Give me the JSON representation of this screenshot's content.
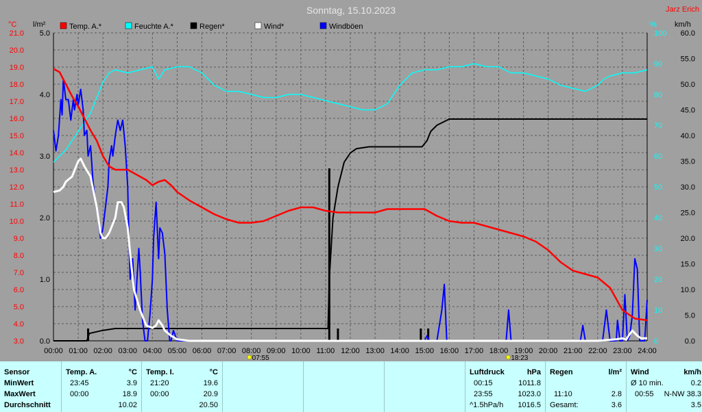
{
  "chart_data": {
    "type": "line",
    "title": "Sonntag, 15.10.2023",
    "station": "Jarz Erich",
    "legend": [
      {
        "name": "Temp. A.*",
        "color": "#ff0000"
      },
      {
        "name": "Feuchte A.*",
        "color": "#00ffff"
      },
      {
        "name": "Regen*",
        "color": "#000000"
      },
      {
        "name": "Wind*",
        "color": "#ffffff"
      },
      {
        "name": "Windböen",
        "color": "#0000ff"
      }
    ],
    "axes": {
      "temp": {
        "unit": "°C",
        "min": 3.0,
        "max": 21.0,
        "ticks": [
          "3.0",
          "4.0",
          "5.0",
          "6.0",
          "7.0",
          "8.0",
          "9.0",
          "10.0",
          "11.0",
          "12.0",
          "13.0",
          "14.0",
          "15.0",
          "16.0",
          "17.0",
          "18.0",
          "19.0",
          "20.0",
          "21.0"
        ]
      },
      "rain": {
        "unit": "l/m²",
        "min": 0.0,
        "max": 5.0,
        "ticks": [
          "0.0",
          "1.0",
          "2.0",
          "3.0",
          "4.0",
          "5.0"
        ]
      },
      "humidity": {
        "unit": "%",
        "min": 0,
        "max": 100,
        "ticks": [
          "0",
          "10",
          "20",
          "30",
          "40",
          "50",
          "60",
          "70",
          "80",
          "90",
          "100"
        ]
      },
      "wind": {
        "unit": "km/h",
        "min": 0.0,
        "max": 60.0,
        "ticks": [
          "0.0",
          "5.0",
          "10.0",
          "15.0",
          "20.0",
          "25.0",
          "30.0",
          "35.0",
          "40.0",
          "45.0",
          "50.0",
          "55.0",
          "60.0"
        ]
      },
      "x": {
        "min": 0,
        "max": 24,
        "ticks": [
          "00:00",
          "01:00",
          "02:00",
          "03:00",
          "04:00",
          "05:00",
          "06:00",
          "07:00",
          "08:00",
          "09:00",
          "10:00",
          "11:00",
          "12:00",
          "13:00",
          "14:00",
          "15:00",
          "16:00",
          "17:00",
          "18:00",
          "19:00",
          "20:00",
          "21:00",
          "22:00",
          "23:00",
          "24:00"
        ]
      }
    },
    "sunrise": {
      "label": "07:55",
      "hour": 7.917
    },
    "sunset": {
      "label": "18:23",
      "hour": 18.383
    },
    "series": {
      "temp": [
        [
          0,
          18.9
        ],
        [
          0.25,
          18.7
        ],
        [
          0.5,
          18.0
        ],
        [
          0.75,
          17.3
        ],
        [
          1.0,
          16.7
        ],
        [
          1.25,
          16.0
        ],
        [
          1.5,
          15.3
        ],
        [
          1.75,
          14.7
        ],
        [
          2.0,
          13.8
        ],
        [
          2.25,
          13.2
        ],
        [
          2.5,
          13.0
        ],
        [
          3.0,
          13.0
        ],
        [
          3.25,
          12.8
        ],
        [
          3.5,
          12.6
        ],
        [
          3.75,
          12.4
        ],
        [
          4.0,
          12.1
        ],
        [
          4.25,
          12.3
        ],
        [
          4.5,
          12.4
        ],
        [
          4.75,
          12.1
        ],
        [
          5.0,
          11.7
        ],
        [
          5.5,
          11.2
        ],
        [
          6.0,
          10.8
        ],
        [
          6.5,
          10.4
        ],
        [
          7.0,
          10.1
        ],
        [
          7.5,
          9.9
        ],
        [
          8.0,
          9.9
        ],
        [
          8.5,
          10.0
        ],
        [
          9.0,
          10.3
        ],
        [
          9.5,
          10.6
        ],
        [
          10.0,
          10.8
        ],
        [
          10.5,
          10.8
        ],
        [
          11.0,
          10.6
        ],
        [
          11.5,
          10.5
        ],
        [
          12.0,
          10.5
        ],
        [
          13.0,
          10.5
        ],
        [
          13.5,
          10.7
        ],
        [
          14.0,
          10.7
        ],
        [
          14.5,
          10.7
        ],
        [
          15.0,
          10.7
        ],
        [
          15.25,
          10.5
        ],
        [
          15.5,
          10.3
        ],
        [
          16.0,
          10.0
        ],
        [
          16.5,
          9.9
        ],
        [
          17.0,
          9.9
        ],
        [
          17.5,
          9.7
        ],
        [
          18.0,
          9.5
        ],
        [
          18.5,
          9.3
        ],
        [
          19.0,
          9.1
        ],
        [
          19.5,
          8.8
        ],
        [
          20.0,
          8.3
        ],
        [
          20.5,
          7.6
        ],
        [
          21.0,
          7.1
        ],
        [
          21.5,
          6.9
        ],
        [
          22.0,
          6.7
        ],
        [
          22.5,
          6.1
        ],
        [
          23.0,
          4.8
        ],
        [
          23.5,
          4.3
        ],
        [
          24.0,
          4.2
        ]
      ],
      "humidity": [
        [
          0,
          58
        ],
        [
          0.5,
          62
        ],
        [
          1.0,
          68
        ],
        [
          1.5,
          74
        ],
        [
          2.0,
          84
        ],
        [
          2.25,
          87
        ],
        [
          2.5,
          88
        ],
        [
          3.0,
          87
        ],
        [
          3.5,
          88
        ],
        [
          4.0,
          89
        ],
        [
          4.25,
          85
        ],
        [
          4.5,
          88
        ],
        [
          5.0,
          89
        ],
        [
          5.5,
          89
        ],
        [
          6.0,
          87
        ],
        [
          6.5,
          83
        ],
        [
          7.0,
          81
        ],
        [
          7.5,
          81
        ],
        [
          8.0,
          80
        ],
        [
          8.5,
          79
        ],
        [
          9.0,
          79
        ],
        [
          9.5,
          80
        ],
        [
          10.0,
          80
        ],
        [
          10.5,
          79
        ],
        [
          11.0,
          78
        ],
        [
          11.5,
          77
        ],
        [
          12.0,
          76
        ],
        [
          12.5,
          75
        ],
        [
          13.0,
          75
        ],
        [
          13.5,
          77
        ],
        [
          14.0,
          83
        ],
        [
          14.5,
          87
        ],
        [
          15.0,
          88
        ],
        [
          15.5,
          88
        ],
        [
          16.0,
          89
        ],
        [
          16.5,
          89
        ],
        [
          17.0,
          90
        ],
        [
          17.5,
          89
        ],
        [
          18.0,
          89
        ],
        [
          18.5,
          87
        ],
        [
          19.0,
          87
        ],
        [
          19.5,
          86
        ],
        [
          20.0,
          85
        ],
        [
          20.5,
          83
        ],
        [
          21.0,
          82
        ],
        [
          21.5,
          81
        ],
        [
          22.0,
          83
        ],
        [
          22.25,
          85
        ],
        [
          22.5,
          86
        ],
        [
          23.0,
          87
        ],
        [
          23.5,
          87
        ],
        [
          24.0,
          88
        ]
      ],
      "rain": [
        [
          0,
          0
        ],
        [
          1.35,
          0
        ],
        [
          1.45,
          0.12
        ],
        [
          2.0,
          0.17
        ],
        [
          2.5,
          0.2
        ],
        [
          3.0,
          0.2
        ],
        [
          4.0,
          0.2
        ],
        [
          5.0,
          0.2
        ],
        [
          6.0,
          0.2
        ],
        [
          7.0,
          0.2
        ],
        [
          8.0,
          0.2
        ],
        [
          9.0,
          0.2
        ],
        [
          10.0,
          0.2
        ],
        [
          11.0,
          0.2
        ],
        [
          11.1,
          0.2
        ],
        [
          11.15,
          1.0
        ],
        [
          11.3,
          2.0
        ],
        [
          11.5,
          2.5
        ],
        [
          11.75,
          2.9
        ],
        [
          12.0,
          3.05
        ],
        [
          12.25,
          3.12
        ],
        [
          12.75,
          3.15
        ],
        [
          13.0,
          3.15
        ],
        [
          14.0,
          3.15
        ],
        [
          14.9,
          3.15
        ],
        [
          15.1,
          3.25
        ],
        [
          15.25,
          3.4
        ],
        [
          15.5,
          3.5
        ],
        [
          15.75,
          3.55
        ],
        [
          16.0,
          3.6
        ],
        [
          17.0,
          3.6
        ],
        [
          18.0,
          3.6
        ],
        [
          19.0,
          3.6
        ],
        [
          20.0,
          3.6
        ],
        [
          21.0,
          3.6
        ],
        [
          22.0,
          3.6
        ],
        [
          23.0,
          3.6
        ],
        [
          24.0,
          3.6
        ]
      ],
      "rain_bars": [
        [
          1.4,
          0.2
        ],
        [
          11.15,
          2.8
        ],
        [
          11.5,
          0.2
        ],
        [
          14.85,
          0.2
        ],
        [
          15.15,
          0.2
        ]
      ],
      "wind": [
        [
          0,
          29
        ],
        [
          0.25,
          29.3
        ],
        [
          0.4,
          30
        ],
        [
          0.5,
          31
        ],
        [
          0.75,
          32
        ],
        [
          1.0,
          35
        ],
        [
          1.1,
          35.5
        ],
        [
          1.25,
          34
        ],
        [
          1.5,
          32
        ],
        [
          1.75,
          26
        ],
        [
          1.9,
          21
        ],
        [
          2.0,
          20
        ],
        [
          2.1,
          20
        ],
        [
          2.25,
          21
        ],
        [
          2.5,
          24
        ],
        [
          2.6,
          27
        ],
        [
          2.75,
          27
        ],
        [
          2.85,
          26
        ],
        [
          3.0,
          22
        ],
        [
          3.1,
          17
        ],
        [
          3.25,
          10
        ],
        [
          3.5,
          6
        ],
        [
          3.75,
          3
        ],
        [
          4.0,
          2.5
        ],
        [
          4.15,
          3
        ],
        [
          4.25,
          4
        ],
        [
          4.4,
          3
        ],
        [
          4.5,
          2
        ],
        [
          4.75,
          1
        ],
        [
          5.0,
          0.3
        ],
        [
          5.5,
          0
        ],
        [
          6,
          0
        ],
        [
          8,
          0
        ],
        [
          10,
          0
        ],
        [
          12,
          0
        ],
        [
          14,
          0
        ],
        [
          16,
          0
        ],
        [
          18,
          0
        ],
        [
          20,
          0
        ],
        [
          22,
          0
        ],
        [
          22.75,
          0.3
        ],
        [
          23.0,
          0.5
        ],
        [
          23.15,
          0.2
        ],
        [
          23.25,
          1
        ],
        [
          23.4,
          2
        ],
        [
          23.5,
          1.5
        ],
        [
          23.6,
          1
        ],
        [
          23.75,
          0.5
        ],
        [
          24.0,
          0.5
        ]
      ],
      "gust": [
        [
          0,
          41
        ],
        [
          0.1,
          37
        ],
        [
          0.2,
          40
        ],
        [
          0.3,
          47
        ],
        [
          0.35,
          44
        ],
        [
          0.4,
          51
        ],
        [
          0.5,
          47
        ],
        [
          0.6,
          47
        ],
        [
          0.7,
          43
        ],
        [
          0.8,
          47
        ],
        [
          0.85,
          45
        ],
        [
          0.95,
          48
        ],
        [
          1.0,
          46
        ],
        [
          1.1,
          49
        ],
        [
          1.2,
          45
        ],
        [
          1.25,
          40
        ],
        [
          1.35,
          41
        ],
        [
          1.4,
          36
        ],
        [
          1.5,
          38
        ],
        [
          1.6,
          31
        ],
        [
          1.7,
          27
        ],
        [
          1.8,
          24
        ],
        [
          1.9,
          20
        ],
        [
          2.0,
          22
        ],
        [
          2.1,
          26
        ],
        [
          2.2,
          30
        ],
        [
          2.25,
          35
        ],
        [
          2.35,
          38
        ],
        [
          2.4,
          36
        ],
        [
          2.5,
          40
        ],
        [
          2.6,
          43
        ],
        [
          2.7,
          41
        ],
        [
          2.8,
          43
        ],
        [
          2.9,
          38
        ],
        [
          3.0,
          30
        ],
        [
          3.05,
          20
        ],
        [
          3.1,
          12
        ],
        [
          3.2,
          16
        ],
        [
          3.3,
          6
        ],
        [
          3.35,
          10
        ],
        [
          3.45,
          18
        ],
        [
          3.5,
          14
        ],
        [
          3.6,
          4
        ],
        [
          3.7,
          0
        ],
        [
          3.8,
          0
        ],
        [
          3.9,
          5
        ],
        [
          4.0,
          12
        ],
        [
          4.05,
          20
        ],
        [
          4.15,
          27
        ],
        [
          4.25,
          16
        ],
        [
          4.3,
          22
        ],
        [
          4.4,
          21
        ],
        [
          4.5,
          17
        ],
        [
          4.6,
          6
        ],
        [
          4.7,
          0
        ],
        [
          4.75,
          0
        ],
        [
          4.85,
          2
        ],
        [
          5.0,
          0
        ],
        [
          5.5,
          0
        ],
        [
          6,
          0
        ],
        [
          10,
          0
        ],
        [
          15.0,
          0
        ],
        [
          15.1,
          1
        ],
        [
          15.2,
          0
        ],
        [
          15.5,
          0
        ],
        [
          15.7,
          6
        ],
        [
          15.8,
          11
        ],
        [
          15.9,
          0
        ],
        [
          18.0,
          0
        ],
        [
          18.3,
          0
        ],
        [
          18.4,
          6
        ],
        [
          18.5,
          0
        ],
        [
          20.0,
          0
        ],
        [
          21.3,
          0
        ],
        [
          21.4,
          3
        ],
        [
          21.5,
          0
        ],
        [
          22.2,
          0
        ],
        [
          22.35,
          6
        ],
        [
          22.5,
          0
        ],
        [
          22.75,
          0
        ],
        [
          22.8,
          4
        ],
        [
          22.9,
          0
        ],
        [
          23.0,
          0
        ],
        [
          23.1,
          9
        ],
        [
          23.2,
          0
        ],
        [
          23.3,
          1
        ],
        [
          23.4,
          5
        ],
        [
          23.5,
          16
        ],
        [
          23.6,
          14
        ],
        [
          23.7,
          0
        ],
        [
          23.9,
          0
        ],
        [
          24.0,
          8
        ]
      ]
    }
  },
  "stats": {
    "sensor": {
      "header": "Sensor",
      "labels": [
        "MinWert",
        "MaxWert",
        "Durchschnitt"
      ]
    },
    "temp_a": {
      "header": "Temp. A.",
      "unit": "°C",
      "min_time": "23:45",
      "min": "3.9",
      "max_time": "00:00",
      "max": "18.9",
      "avg": "10.02"
    },
    "temp_i": {
      "header": "Temp. I.",
      "unit": "°C",
      "min_time": "21:20",
      "min": "19.6",
      "max_time": "00:00",
      "max": "20.9",
      "avg": "20.50"
    },
    "pressure": {
      "header": "Luftdruck",
      "unit": "hPa",
      "min_time": "00:15",
      "min": "1011.8",
      "max_time": "23:55",
      "max": "1023.0",
      "trend": "^1.5hPa/h",
      "avg": "1016.5"
    },
    "rain": {
      "header": "Regen",
      "unit": "l/m²",
      "max_time": "11:10",
      "max": "2.8",
      "total_label": "Gesamt:",
      "total": "3.6"
    },
    "wind": {
      "header": "Wind",
      "unit": "km/h",
      "min_label": "Ø 10 min.",
      "min": "0.2",
      "max_time": "00:55",
      "max": "N-NW 38.3",
      "avg": "3.5"
    }
  }
}
